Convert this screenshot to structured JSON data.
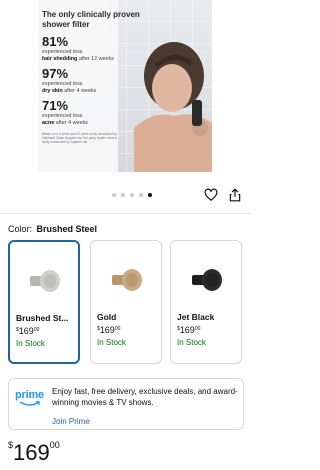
{
  "hero": {
    "title": "The only clinically proven shower filter",
    "stats": [
      {
        "pct": "81%",
        "line1": "experienced less",
        "line2_bold": "hair shedding",
        "line2_rest": " after 12 weeks"
      },
      {
        "pct": "97%",
        "line1": "experienced less",
        "line2_bold": "dry skin",
        "line2_rest": " after 4 weeks"
      },
      {
        "pct": "71%",
        "line1": "experienced less",
        "line2_bold": "acne",
        "line2_rest": " after 4 weeks"
      }
    ],
    "fine_print": "Based on a 4-week and 12-week study conducted by Validated Claim Support and 3rd party Jupiter clinical study conducted by Jupiter's lab."
  },
  "gallery": {
    "total": 5,
    "active_index": 4
  },
  "color": {
    "label": "Color:",
    "value": "Brushed Steel"
  },
  "variants": [
    {
      "name": "Brushed St...",
      "currency": "$",
      "whole": "169",
      "cents": "00",
      "stock": "In Stock",
      "selected": true,
      "finish": "#c9c9c6"
    },
    {
      "name": "Gold",
      "currency": "$",
      "whole": "169",
      "cents": "00",
      "stock": "In Stock",
      "selected": false,
      "finish": "#c7a77f"
    },
    {
      "name": "Jet Black",
      "currency": "$",
      "whole": "169",
      "cents": "00",
      "stock": "In Stock",
      "selected": false,
      "finish": "#2a2a2a"
    }
  ],
  "prime": {
    "logo": "prime",
    "message": "Enjoy fast, free delivery, exclusive deals, and award-winning movies & TV shows.",
    "join": "Join Prime"
  },
  "price": {
    "currency": "$",
    "whole": "169",
    "cents": "00"
  },
  "colors": {
    "accent": "#2162a1",
    "stock": "#007600",
    "prime": "#1a98ff"
  }
}
